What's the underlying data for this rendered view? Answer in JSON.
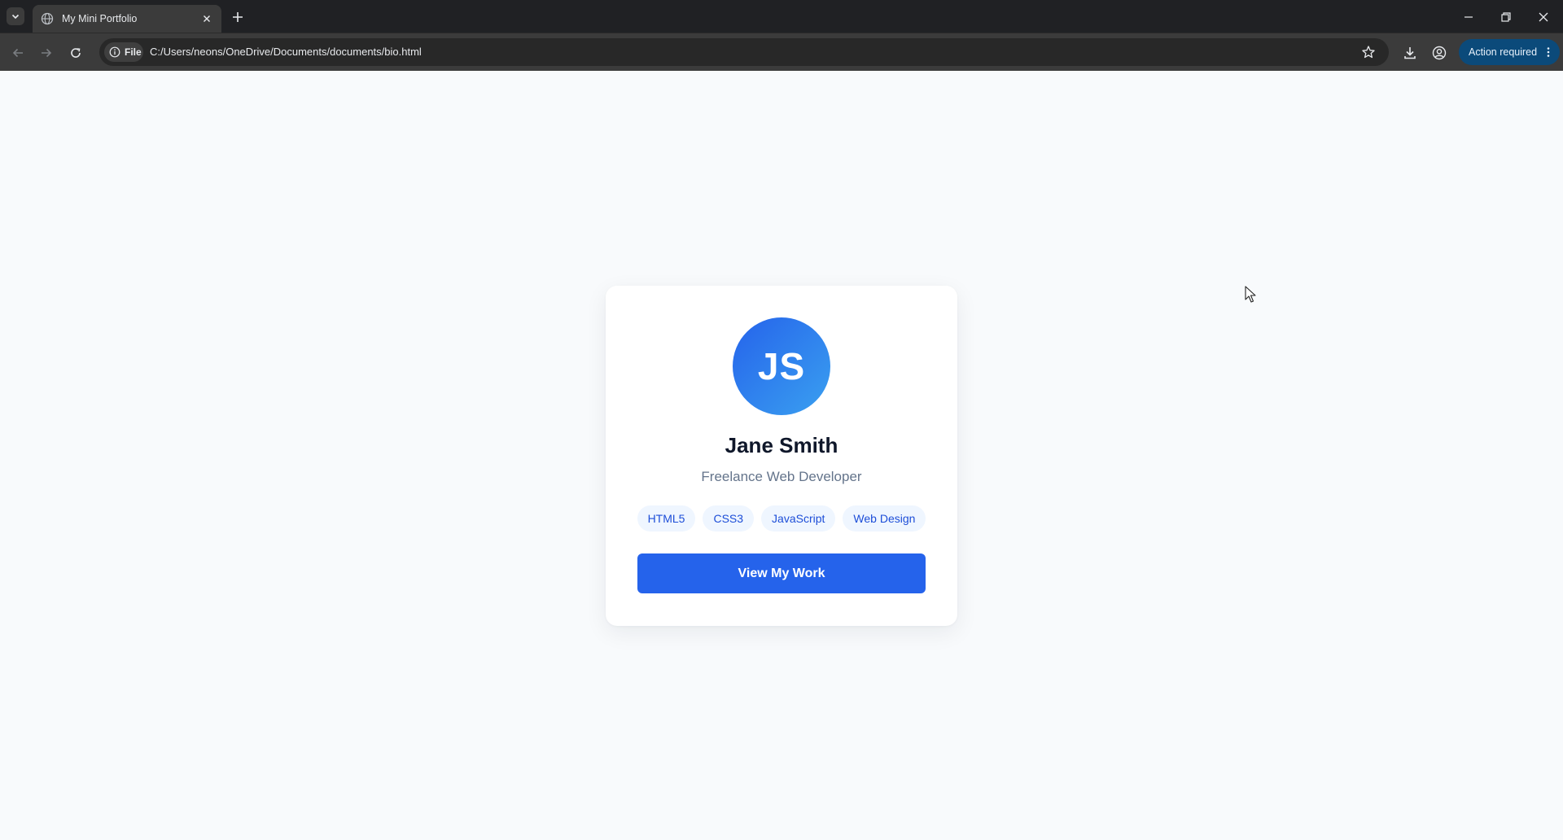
{
  "browser": {
    "tab": {
      "title": "My Mini Portfolio",
      "favicon": "globe-icon"
    },
    "address": {
      "chip_label": "File",
      "url": "C:/Users/neons/OneDrive/Documents/documents/bio.html"
    },
    "action_button": {
      "label": "Action required"
    }
  },
  "profile": {
    "initials": "JS",
    "name": "Jane Smith",
    "role": "Freelance Web Developer",
    "skills": [
      "HTML5",
      "CSS3",
      "JavaScript",
      "Web Design"
    ],
    "cta_label": "View My Work"
  },
  "colors": {
    "page_bg": "#f8fafc",
    "accent": "#2563eb",
    "avatar_gradient_start": "#2563eb",
    "avatar_gradient_end": "#3aa0f0",
    "tag_bg": "#eff6ff",
    "tag_text": "#1d4ed8",
    "name_text": "#0f172a",
    "role_text": "#64748b"
  }
}
